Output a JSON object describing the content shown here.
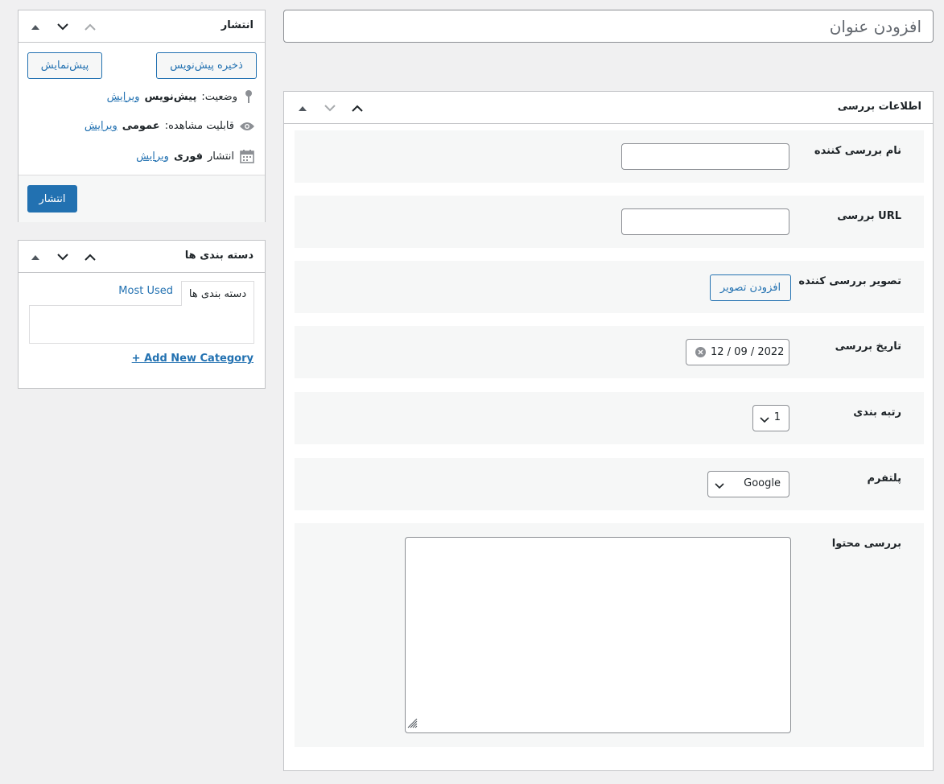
{
  "title_field": {
    "placeholder": "افزودن عنوان"
  },
  "review_box": {
    "title": "اطلاعات بررسی",
    "fields": {
      "reviewer_name": {
        "label": "نام بررسی کننده",
        "value": ""
      },
      "review_url": {
        "label": "URL بررسی",
        "value": ""
      },
      "reviewer_image": {
        "label": "تصویر بررسی کننده",
        "button_label": "افزودن تصویر"
      },
      "review_date": {
        "label": "تاریخ بررسی",
        "value": "12 / 09 / 2022"
      },
      "rating": {
        "label": "رتبه بندی",
        "value": "1"
      },
      "platform": {
        "label": "پلتفرم",
        "value": "Google"
      },
      "review_content": {
        "label": "بررسی محتوا",
        "value": ""
      }
    }
  },
  "publish_box": {
    "title": "انتشار",
    "save_draft_label": "ذخیره پیش‌نویس",
    "preview_label": "پیش‌نمایش",
    "status": {
      "prefix": "وضعیت:",
      "value": "پیش‌نویس",
      "edit_link": "ویرایش"
    },
    "visibility": {
      "prefix": "قابلیت مشاهده:",
      "value": "عمومی",
      "edit_link": "ویرایش"
    },
    "schedule": {
      "prefix": "انتشار",
      "value": "فوری",
      "edit_link": "ویرایش"
    },
    "publish_label": "انتشار"
  },
  "categories_box": {
    "title": "دسته بندی ها",
    "tab_all": "دسته بندی ها",
    "tab_most_used": "Most Used",
    "add_new_link": "+ Add New Category"
  },
  "colors": {
    "accent": "#2271b1",
    "background": "#f0f0f1",
    "border": "#c3c4c7"
  },
  "icons": [
    "chevron-up-icon",
    "chevron-down-icon",
    "triangle-up-icon",
    "pin-icon",
    "eye-icon",
    "calendar-icon",
    "clear-icon",
    "resize-grip-icon"
  ]
}
